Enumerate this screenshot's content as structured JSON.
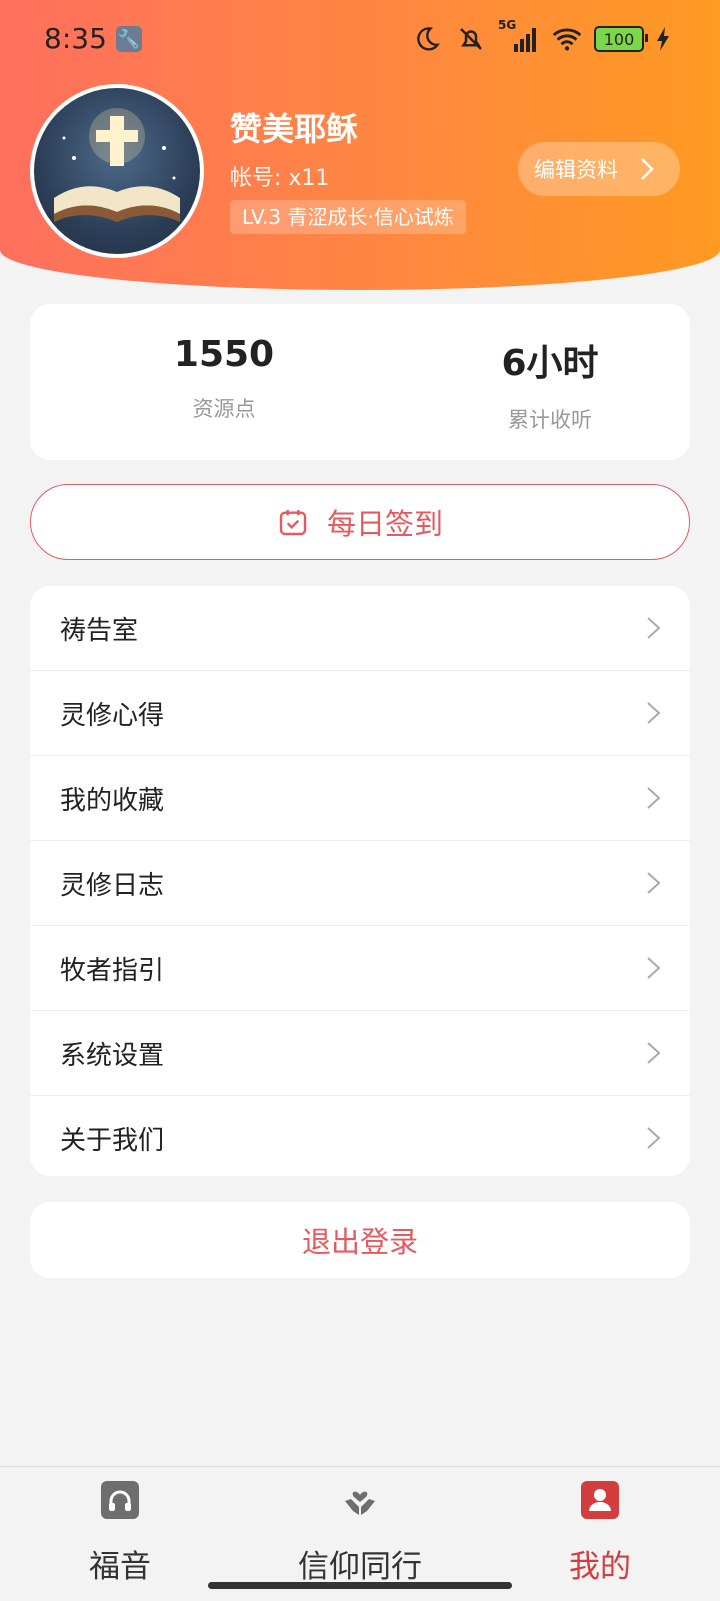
{
  "status_bar": {
    "time": "8:35",
    "network": "5G",
    "battery": "100",
    "icons": [
      "wrench-icon",
      "moon-icon",
      "mute-icon",
      "signal-icon",
      "wifi-icon",
      "battery-icon",
      "charging-icon"
    ]
  },
  "profile": {
    "name": "赞美耶稣",
    "account": "帐号: x11",
    "level": "LV.3 青涩成长·信心试炼",
    "edit_label": "编辑资料"
  },
  "stats": [
    {
      "value": "1550",
      "label": "资源点"
    },
    {
      "value": "6小时",
      "label": "累计收听"
    }
  ],
  "checkin": {
    "label": "每日签到"
  },
  "menu": [
    {
      "label": "祷告室"
    },
    {
      "label": "灵修心得"
    },
    {
      "label": "我的收藏"
    },
    {
      "label": "灵修日志"
    },
    {
      "label": "牧者指引"
    },
    {
      "label": "系统设置"
    },
    {
      "label": "关于我们"
    }
  ],
  "logout": {
    "label": "退出登录"
  },
  "tabbar": {
    "items": [
      {
        "label": "福音",
        "active": false
      },
      {
        "label": "信仰同行",
        "active": false
      },
      {
        "label": "我的",
        "active": true
      }
    ]
  },
  "colors": {
    "accent": "#e45a5f",
    "header_start": "#ff6f5e",
    "header_end": "#ff9a22",
    "tab_inactive": "#333333",
    "tab_icon_inactive": "#6e6e6e",
    "tab_active": "#d43d3d"
  }
}
